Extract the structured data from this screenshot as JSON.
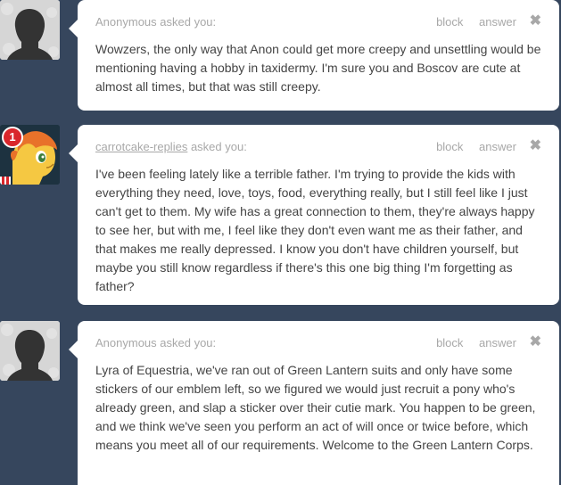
{
  "asks": [
    {
      "asker_name": "Anonymous",
      "asker_suffix": " asked you:",
      "question": "Wowzers, the only way that Anon could get more creepy and unsettling would be mentioning having a hobby in taxidermy. I'm sure you and Boscov are cute at almost all times, but that was still creepy.",
      "block_label": "block",
      "answer_label": "answer",
      "close_glyph": "✖"
    },
    {
      "asker_name": "carrotcake-replies",
      "asker_suffix": " asked you:",
      "question": "I've been feeling lately like a terrible father. I'm trying to provide the kids with everything they need, love, toys, food, everything really, but I still feel like I just can't get to them. My wife has a great connection to them, they're always happy to see her, but with me, I feel like they don't even want me as their father, and that makes me really depressed. I know you don't have children yourself, but maybe you still know regardless if there's this one big thing I'm forgetting as father?",
      "block_label": "block",
      "answer_label": "answer",
      "close_glyph": "✖",
      "notification_count": "1"
    },
    {
      "asker_name": "Anonymous",
      "asker_suffix": " asked you:",
      "question": "Lyra of Equestria, we've ran out of Green Lantern suits and only have some stickers of our emblem left, so we figured we would just recruit a pony who's already green, and slap a sticker over their cutie mark. You happen to be green, and we think we've seen you perform an act of will once or twice before, which means you meet all of our requirements. Welcome to the Green Lantern Corps.",
      "block_label": "block",
      "answer_label": "answer",
      "close_glyph": "✖"
    }
  ],
  "colors": {
    "background": "#36465d",
    "card": "#ffffff",
    "meta_text": "#a8a8a8",
    "body_text": "#444444",
    "badge": "#d9262b",
    "avatar_anon_bg": "#d6d6d6",
    "avatar_anon_silhouette": "#333333",
    "avatar_carrot_bg": "#1d3240",
    "avatar_carrot_pony": "#f5c842",
    "avatar_carrot_mane": "#e8722a"
  },
  "icons": {
    "anon_avatar": "anonymous-silhouette-icon",
    "close": "close-icon"
  }
}
